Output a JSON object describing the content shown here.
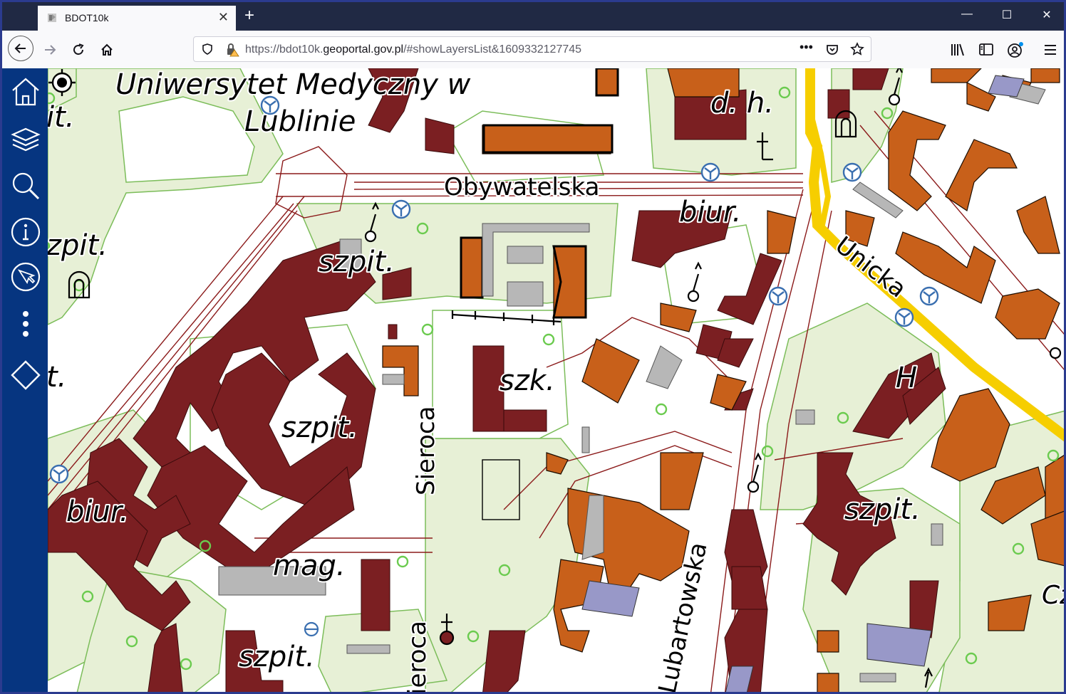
{
  "browser": {
    "tab_title": "BDOT10k",
    "url_prefix": "https://bdot10k.",
    "url_domain": "geoportal.gov.pl",
    "url_suffix": "/#showLayersList&1609332127745"
  },
  "map": {
    "labels": {
      "university_line1": "Uniwersytet Medyczny w",
      "university_line2": "Lublinie",
      "street_obywatelska": "Obywatelska",
      "street_unicka": "Unicka",
      "street_sieroca": "Sieroca",
      "street_sieroca2": "ieroca",
      "street_lubartowska": "Lubartowska",
      "szpit_1": "szpit.",
      "szpit_2": "szpit.",
      "szpit_3": "szpit.",
      "szpit_4": "szpit.",
      "zpit_edge": "zpit.",
      "it_edge": "it.",
      "t_edge": "t.",
      "biur_1": "biur.",
      "biur_2": "biur.",
      "szk": "szk.",
      "mag": "mag.",
      "dh": "d. h.",
      "hospital_h": "H",
      "cz_edge": "Cz"
    }
  }
}
